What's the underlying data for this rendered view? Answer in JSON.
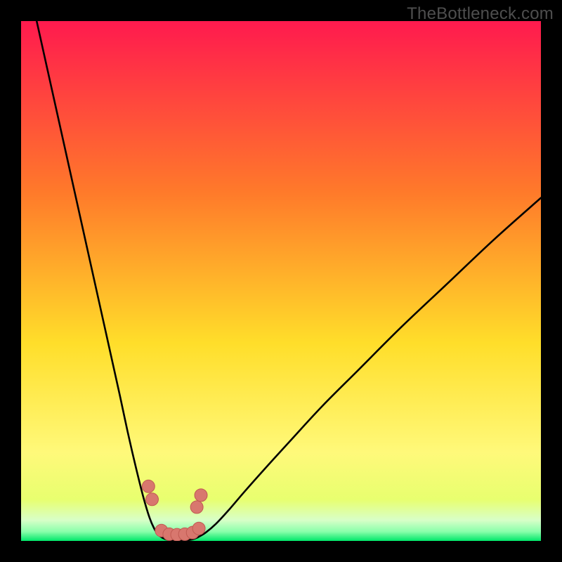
{
  "watermark": "TheBottleneck.com",
  "colors": {
    "frame": "#000000",
    "gradient_top": "#ff1a4e",
    "gradient_mid1": "#ff7a2a",
    "gradient_mid2": "#ffde2a",
    "gradient_low": "#e8ff6f",
    "gradient_base_pale": "#d8ffc8",
    "gradient_base": "#00e76a",
    "curve": "#000000",
    "marker_fill": "#d8776e",
    "marker_stroke": "#c05a52"
  },
  "chart_data": {
    "type": "line",
    "title": "",
    "xlabel": "",
    "ylabel": "",
    "xlim": [
      0,
      100
    ],
    "ylim": [
      0,
      100
    ],
    "series": [
      {
        "name": "left-branch",
        "x": [
          3,
          5,
          7,
          9,
          11,
          13,
          15,
          17,
          19,
          20.5,
          22,
          23.5,
          24.7,
          25.6,
          26.4,
          27.2
        ],
        "y": [
          100,
          91,
          82,
          73,
          64,
          55,
          46,
          37,
          28,
          21,
          14.5,
          8.5,
          4.5,
          2.4,
          1.2,
          0.6
        ]
      },
      {
        "name": "valley-floor",
        "x": [
          27.2,
          28,
          29,
          30,
          31,
          32,
          33,
          34
        ],
        "y": [
          0.6,
          0.25,
          0.1,
          0.1,
          0.1,
          0.15,
          0.3,
          0.7
        ]
      },
      {
        "name": "right-branch",
        "x": [
          34,
          35.5,
          37.5,
          40,
          43,
          47,
          52,
          58,
          65,
          73,
          82,
          91,
          100
        ],
        "y": [
          0.7,
          1.6,
          3.3,
          6,
          9.5,
          14,
          19.5,
          26,
          33,
          41,
          49.5,
          58,
          66
        ]
      }
    ],
    "markers": [
      {
        "x": 24.5,
        "y": 10.5
      },
      {
        "x": 25.2,
        "y": 8.0
      },
      {
        "x": 27.0,
        "y": 2.0
      },
      {
        "x": 28.5,
        "y": 1.3
      },
      {
        "x": 30.0,
        "y": 1.2
      },
      {
        "x": 31.5,
        "y": 1.3
      },
      {
        "x": 33.0,
        "y": 1.6
      },
      {
        "x": 34.2,
        "y": 2.4
      },
      {
        "x": 33.8,
        "y": 6.5
      },
      {
        "x": 34.6,
        "y": 8.8
      }
    ]
  }
}
